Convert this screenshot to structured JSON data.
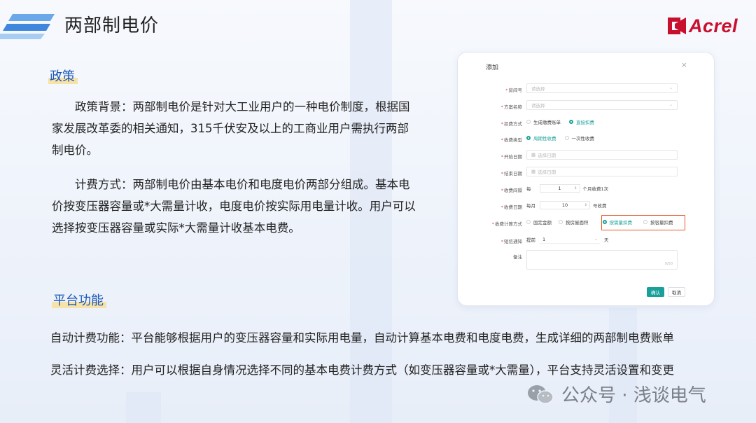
{
  "header": {
    "title": "两部制电价",
    "brand": "Acrel"
  },
  "policy": {
    "tag": "政策",
    "background": "政策背景：两部制电价是针对大工业用户的一种电价制度，根据国家发展改革委的相关通知，315千伏安及以上的工商业用户需执行两部制电价。",
    "billing": "计费方式：两部制电价由基本电价和电度电价两部分组成。基本电价按变压器容量或*大需量计收，电度电价按实际用电量计收。用户可以选择按变压器容量或实际*大需量计收基本电费。"
  },
  "platform": {
    "tag": "平台功能",
    "auto": "自动计费功能：平台能够根据用户的变压器容量和实际用电量，自动计算基本电费和电度电费，生成详细的两部制电费账单",
    "flexible": "灵活计费选择：用户可以根据自身情况选择不同的基本电费计费方式（如变压器容量或*大需量），平台支持灵活设置和变更"
  },
  "dialog": {
    "title": "添加",
    "close": "×",
    "fields": {
      "room": {
        "label": "房间号",
        "placeholder": "请选择"
      },
      "plan": {
        "label": "方案名称",
        "placeholder": "请选择"
      },
      "deduct": {
        "label": "扣费方式",
        "opt1": "生成缴费账单",
        "opt2": "直接扣费"
      },
      "charge_type": {
        "label": "收费类型",
        "opt1": "周期性收费",
        "opt2": "一次性收费"
      },
      "start": {
        "label": "开始日期",
        "placeholder": "选择日期"
      },
      "end": {
        "label": "结束日期",
        "placeholder": "选择日期"
      },
      "interval": {
        "label": "收费间隔",
        "prefix": "每",
        "value": "1",
        "suffix": "个月收费1次"
      },
      "day": {
        "label": "收费日期",
        "prefix": "每月",
        "value": "10",
        "suffix": "号收费"
      },
      "calc": {
        "label": "收费计算方式",
        "opt1": "固定金额",
        "opt2": "按房屋面积",
        "opt3": "按需量扣费",
        "opt4": "按容量扣费"
      },
      "sms": {
        "label": "短信通知",
        "prefix": "提前",
        "value": "1",
        "suffix": "天"
      },
      "note": {
        "label": "备注",
        "counter": "0/50"
      }
    },
    "ok": "确认",
    "cancel": "取消"
  },
  "watermark": "公众号 · 浅谈电气",
  "colors": {
    "accent": "#1aa09a",
    "highlight": "#e55a2b",
    "brand": "#c8102e",
    "tag": "#1a56b8"
  }
}
